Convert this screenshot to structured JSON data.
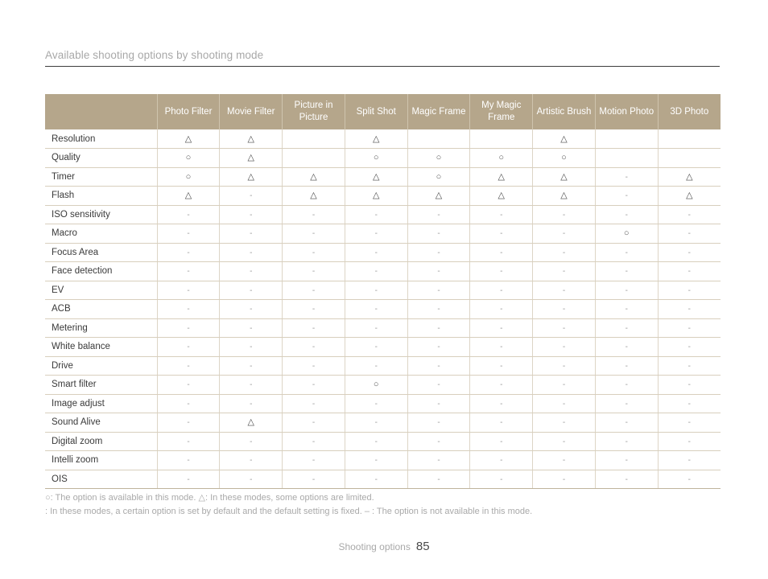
{
  "section": {
    "title": "Available shooting options by shooting mode"
  },
  "table": {
    "corner_label": "",
    "columns": [
      "Photo Filter",
      "Movie Filter",
      "Picture in Picture",
      "Split Shot",
      "Magic Frame",
      "My Magic Frame",
      "Artistic Brush",
      "Motion Photo",
      "3D Photo"
    ],
    "rows": [
      {
        "label": "Resolution",
        "cells": [
          "△",
          "△",
          "",
          "△",
          "",
          "",
          "△",
          "",
          ""
        ]
      },
      {
        "label": "Quality",
        "cells": [
          "○",
          "△",
          "",
          "○",
          "○",
          "○",
          "○",
          "",
          ""
        ]
      },
      {
        "label": "Timer",
        "cells": [
          "○",
          "△",
          "△",
          "△",
          "○",
          "△",
          "△",
          "-",
          "△"
        ]
      },
      {
        "label": "Flash",
        "cells": [
          "△",
          "-",
          "△",
          "△",
          "△",
          "△",
          "△",
          "-",
          "△"
        ]
      },
      {
        "label": "ISO sensitivity",
        "cells": [
          "-",
          "-",
          "-",
          "-",
          "-",
          "-",
          "-",
          "-",
          "-"
        ]
      },
      {
        "label": "Macro",
        "cells": [
          "-",
          "-",
          "-",
          "-",
          "-",
          "-",
          "-",
          "○",
          "-"
        ]
      },
      {
        "label": "Focus Area",
        "cells": [
          "-",
          "-",
          "-",
          "-",
          "-",
          "-",
          "-",
          "-",
          "-"
        ]
      },
      {
        "label": "Face detection",
        "cells": [
          "-",
          "-",
          "-",
          "-",
          "-",
          "-",
          "-",
          "-",
          "-"
        ]
      },
      {
        "label": "EV",
        "cells": [
          "-",
          "-",
          "-",
          "-",
          "-",
          "-",
          "-",
          "-",
          "-"
        ]
      },
      {
        "label": "ACB",
        "cells": [
          "-",
          "-",
          "-",
          "-",
          "-",
          "-",
          "-",
          "-",
          "-"
        ]
      },
      {
        "label": "Metering",
        "cells": [
          "-",
          "-",
          "-",
          "-",
          "-",
          "-",
          "-",
          "-",
          "-"
        ]
      },
      {
        "label": "White balance",
        "cells": [
          "-",
          "-",
          "-",
          "-",
          "-",
          "-",
          "-",
          "-",
          "-"
        ]
      },
      {
        "label": "Drive",
        "cells": [
          "-",
          "-",
          "-",
          "-",
          "-",
          "-",
          "-",
          "-",
          "-"
        ]
      },
      {
        "label": "Smart filter",
        "cells": [
          "-",
          "-",
          "-",
          "○",
          "-",
          "-",
          "-",
          "-",
          "-"
        ]
      },
      {
        "label": "Image adjust",
        "cells": [
          "-",
          "-",
          "-",
          "-",
          "-",
          "-",
          "-",
          "-",
          "-"
        ]
      },
      {
        "label": "Sound Alive",
        "cells": [
          "-",
          "△",
          "-",
          "-",
          "-",
          "-",
          "-",
          "-",
          "-"
        ]
      },
      {
        "label": "Digital zoom",
        "cells": [
          "-",
          "-",
          "-",
          "-",
          "-",
          "-",
          "-",
          "-",
          "-"
        ]
      },
      {
        "label": "Intelli zoom",
        "cells": [
          "-",
          "-",
          "-",
          "-",
          "-",
          "-",
          "-",
          "-",
          "-"
        ]
      },
      {
        "label": "OIS",
        "cells": [
          "-",
          "-",
          "-",
          "-",
          "-",
          "-",
          "-",
          "-",
          "-"
        ]
      }
    ]
  },
  "legend": {
    "line1": "○: The option is available in this mode.    △: In these modes, some options are limited.",
    "line2": ": In these modes, a certain option is set by default and the default setting is fixed.  – : The option is not available in this mode."
  },
  "footer": {
    "label": "Shooting options",
    "page": "85"
  },
  "colors": {
    "header_bg": "#b5a68b",
    "header_text": "#ffffff",
    "border_light": "#ddd5c6",
    "border_row": "#d8cfbd",
    "text": "#3a3a3a",
    "muted": "#a9a9a9",
    "rule": "#3d3d3d"
  }
}
